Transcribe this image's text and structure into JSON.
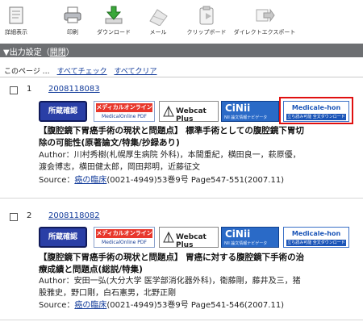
{
  "toolbar": {
    "items": [
      {
        "label": "詳細表示",
        "icon": "detail-icon"
      },
      {
        "label": "印刷",
        "icon": "printer-icon"
      },
      {
        "label": "ダウンロード",
        "icon": "download-icon"
      },
      {
        "label": "メール",
        "icon": "mail-icon"
      },
      {
        "label": "クリップボード",
        "icon": "clipboard-icon"
      },
      {
        "label": "ダイレクトエクスポート",
        "icon": "direct-export-icon"
      }
    ]
  },
  "output": {
    "label": "▼出力設定（",
    "link": "開閉",
    "close": "）"
  },
  "pagebar": {
    "label": "このページ …",
    "check_all": "すべてチェック",
    "clear_all": "すべてクリア"
  },
  "badges": {
    "shozo": "所蔵確認",
    "mol_top": "メディカルオンライン",
    "mol_bottom": "MedicalOnline PDF",
    "webcat": "Webcat Plus",
    "cinii_top": "CiNii",
    "cinii_bottom": "NII 論文情報ナビゲータ",
    "ehon_top": "Medicale-hon",
    "ehon_bottom": "立ち読み可能 全文ダウンロード"
  },
  "records": [
    {
      "num": "1",
      "id": "2008118083",
      "title_line1": "【腹腔鏡下胃癌手術の現状と問題点】 標準手術としての腹腔鏡下胃切",
      "title_line2": "除の可能性(原著論文/特集/抄録あり)",
      "author_line1": "Author：川村秀樹(札幌厚生病院 外科)，本間重紀，横田良一，萩原優，",
      "author_line2": "渡会博志，横田健太郎，岡田邦明，近藤征文",
      "source_prefix": "Source：",
      "journal": "癌の臨床",
      "source_rest": "(0021-4949)53巻9号 Page547-551(2007.11)"
    },
    {
      "num": "2",
      "id": "2008118082",
      "title_line1": "【腹腔鏡下胃癌手術の現状と問題点】 胃癌に対する腹腔鏡下手術の治",
      "title_line2": "療成績と問題点(総説/特集)",
      "author_line1": "Author：安田一弘(大分大学 医学部消化器外科)，衛藤剛，藤井及三，猪",
      "author_line2": "股雅史，野口剛，白石憲男，北野正剛",
      "source_prefix": "Source：",
      "journal": "癌の臨床",
      "source_rest": "(0021-4949)53巻9号 Page541-546(2007.11)"
    }
  ]
}
